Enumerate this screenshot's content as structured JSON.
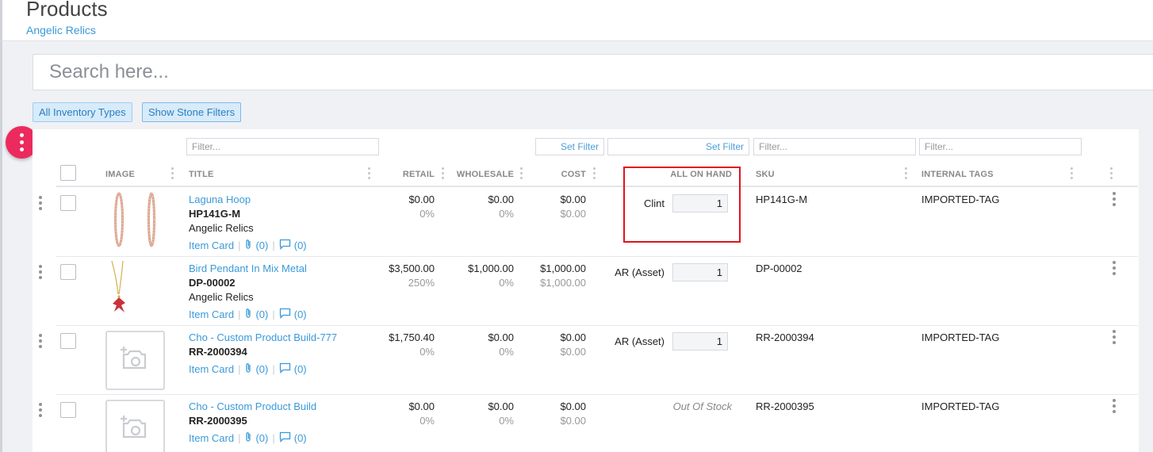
{
  "header": {
    "title": "Products",
    "subtitle": "Angelic Relics"
  },
  "search": {
    "placeholder": "Search here..."
  },
  "buttons": {
    "inventory_types": "All Inventory Types",
    "stone_filters": "Show Stone Filters"
  },
  "filters": {
    "title_placeholder": "Filter...",
    "cost_set_filter": "Set Filter",
    "onhand_set_filter": "Set Filter",
    "sku_placeholder": "Filter...",
    "tags_placeholder": "Filter..."
  },
  "columns": {
    "image": "IMAGE",
    "title": "TITLE",
    "retail": "RETAIL",
    "wholesale": "WHOLESALE",
    "cost": "COST",
    "on_hand": "ALL ON HAND",
    "sku": "SKU",
    "tags": "INTERNAL TAGS"
  },
  "rows": [
    {
      "title": "Laguna Hoop",
      "sku_bold": "HP141G-M",
      "vendor": "Angelic Relics",
      "item_card": "Item Card",
      "attachments": "(0)",
      "comments": "(0)",
      "retail": "$0.00",
      "retail_pct": "0%",
      "wholesale": "$0.00",
      "wholesale_pct": "0%",
      "cost": "$0.00",
      "cost_sub": "$0.00",
      "location": "Clint",
      "qty": "1",
      "sku": "HP141G-M",
      "tags": "IMPORTED-TAG"
    },
    {
      "title": "Bird Pendant In Mix Metal",
      "sku_bold": "DP-00002",
      "vendor": "Angelic Relics",
      "item_card": "Item Card",
      "attachments": "(0)",
      "comments": "(0)",
      "retail": "$3,500.00",
      "retail_pct": "250%",
      "wholesale": "$1,000.00",
      "wholesale_pct": "0%",
      "cost": "$1,000.00",
      "cost_sub": "$1,000.00",
      "location": "AR (Asset)",
      "qty": "1",
      "sku": "DP-00002",
      "tags": ""
    },
    {
      "title": "Cho - Custom Product Build-777",
      "sku_bold": "RR-2000394",
      "vendor": "",
      "item_card": "Item Card",
      "attachments": "(0)",
      "comments": "(0)",
      "retail": "$1,750.40",
      "retail_pct": "0%",
      "wholesale": "$0.00",
      "wholesale_pct": "0%",
      "cost": "$0.00",
      "cost_sub": "$0.00",
      "location": "AR (Asset)",
      "qty": "1",
      "sku": "RR-2000394",
      "tags": "IMPORTED-TAG"
    },
    {
      "title": "Cho - Custom Product Build",
      "sku_bold": "RR-2000395",
      "vendor": "",
      "item_card": "Item Card",
      "attachments": "(0)",
      "comments": "(0)",
      "retail": "$0.00",
      "retail_pct": "0%",
      "wholesale": "$0.00",
      "wholesale_pct": "0%",
      "cost": "$0.00",
      "cost_sub": "$0.00",
      "stock_status": "Out Of Stock",
      "sku": "RR-2000395",
      "tags": "IMPORTED-TAG"
    }
  ],
  "colors": {
    "accent": "#3a9ad9",
    "fab": "#ec2a5e",
    "highlight": "#e0131b"
  }
}
